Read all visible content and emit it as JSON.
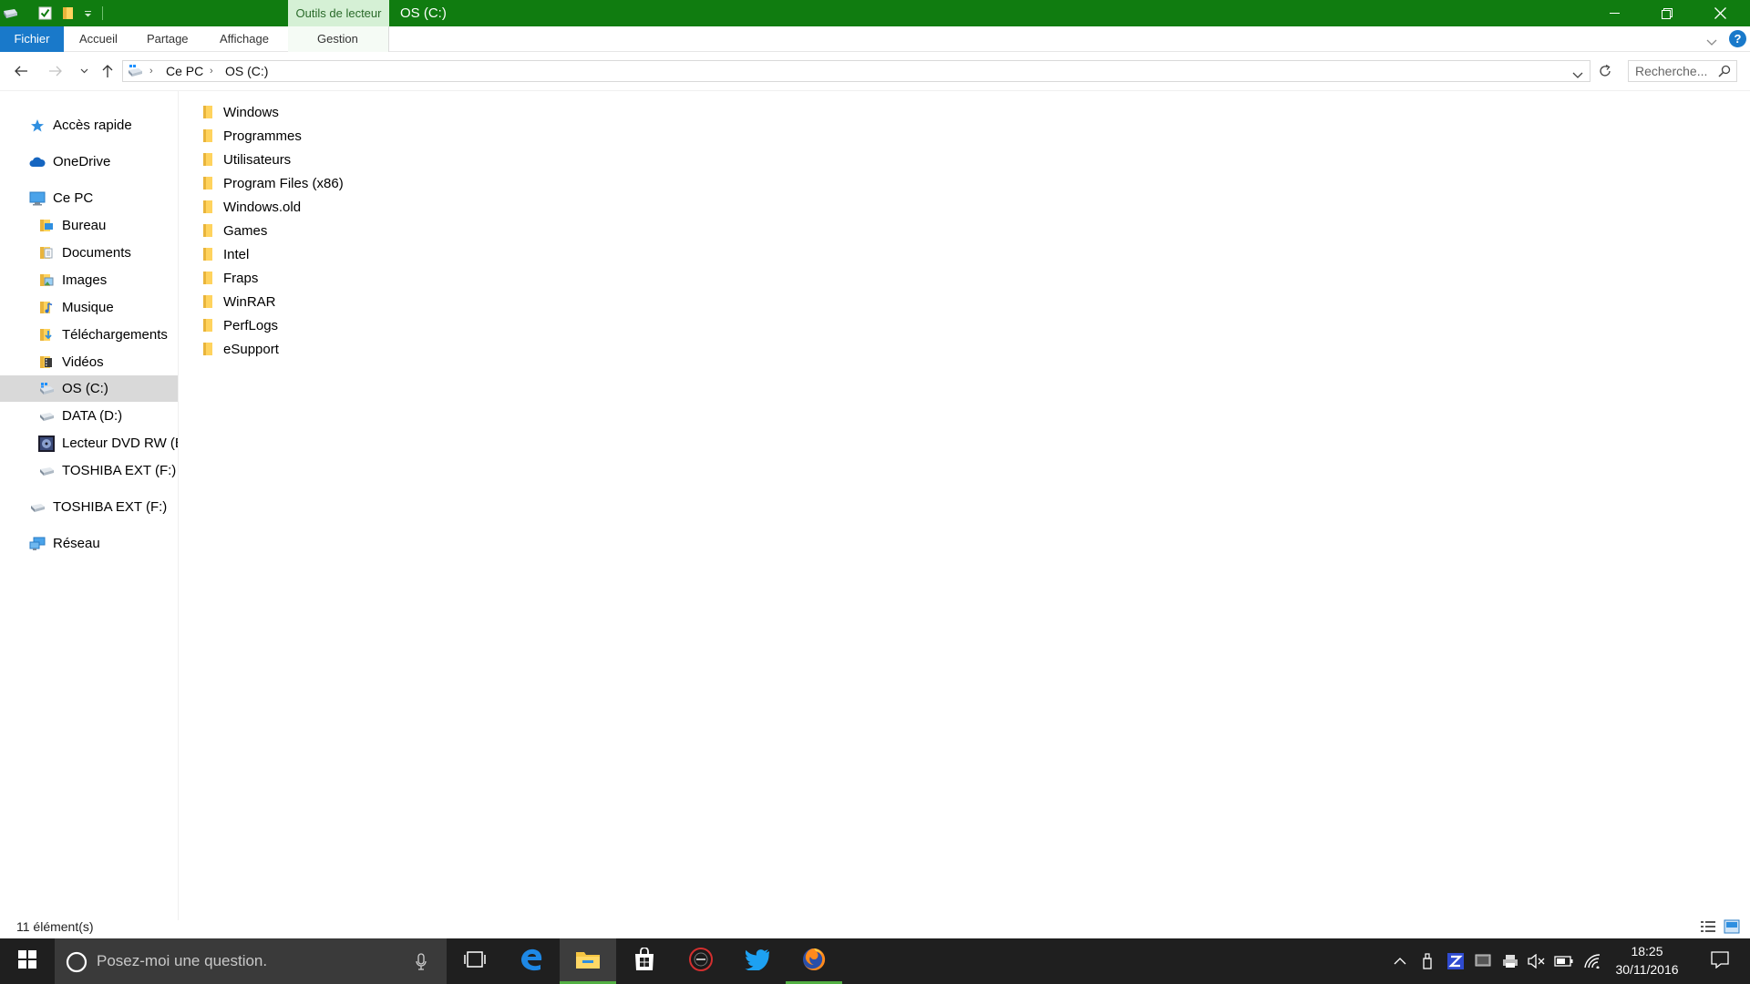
{
  "window": {
    "title": "OS (C:)",
    "context_tab_label": "Outils de lecteur",
    "accent_color": "#107c10"
  },
  "ribbon": {
    "tabs": [
      {
        "label": "Fichier"
      },
      {
        "label": "Accueil"
      },
      {
        "label": "Partage"
      },
      {
        "label": "Affichage"
      },
      {
        "label": "Gestion"
      }
    ],
    "help_label": "?"
  },
  "address": {
    "crumbs": [
      "Ce PC",
      "OS (C:)"
    ],
    "search_placeholder": "Recherche..."
  },
  "navpane": {
    "items": [
      {
        "label": "Accès rapide",
        "icon": "star-icon"
      },
      {
        "label": "OneDrive",
        "icon": "cloud-icon"
      },
      {
        "label": "Ce PC",
        "icon": "computer-icon"
      },
      {
        "label": "Bureau",
        "icon": "desktop-folder-icon"
      },
      {
        "label": "Documents",
        "icon": "documents-icon"
      },
      {
        "label": "Images",
        "icon": "images-icon"
      },
      {
        "label": "Musique",
        "icon": "music-icon"
      },
      {
        "label": "Téléchargements",
        "icon": "downloads-icon"
      },
      {
        "label": "Vidéos",
        "icon": "videos-icon"
      },
      {
        "label": "OS (C:)",
        "icon": "system-drive-icon"
      },
      {
        "label": "DATA (D:)",
        "icon": "drive-icon"
      },
      {
        "label": "Lecteur DVD RW (E:",
        "icon": "dvd-drive-icon"
      },
      {
        "label": "TOSHIBA EXT (F:)",
        "icon": "drive-icon"
      },
      {
        "label": "TOSHIBA EXT (F:)",
        "icon": "drive-icon"
      },
      {
        "label": "Réseau",
        "icon": "network-icon"
      }
    ]
  },
  "files": [
    {
      "name": "Windows"
    },
    {
      "name": "Programmes"
    },
    {
      "name": "Utilisateurs"
    },
    {
      "name": "Program Files (x86)"
    },
    {
      "name": "Windows.old"
    },
    {
      "name": "Games"
    },
    {
      "name": "Intel"
    },
    {
      "name": "Fraps"
    },
    {
      "name": "WinRAR"
    },
    {
      "name": "PerfLogs"
    },
    {
      "name": "eSupport"
    }
  ],
  "status": {
    "item_count": "11 élément(s)"
  },
  "taskbar": {
    "search_placeholder": "Posez-moi une question.",
    "time": "18:25",
    "date": "30/11/2016"
  }
}
